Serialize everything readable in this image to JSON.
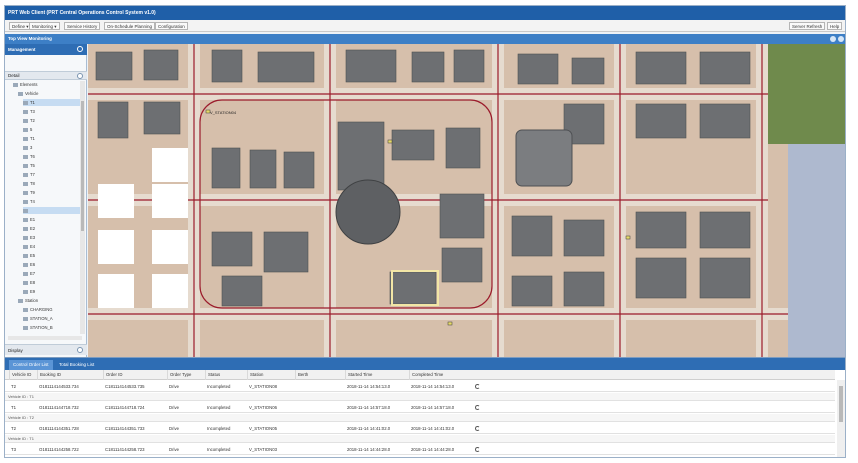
{
  "window": {
    "title": "PRT Web Client (PRT Central Operations Control System v1.0)"
  },
  "menu": {
    "define": "Define",
    "monitoring": "Monitoring",
    "service_history": "Service History",
    "on_schedule_planning": "On-Schedule Planning",
    "configuration": "Configuration",
    "server_refresh": "Server Refresh",
    "help": "Help"
  },
  "view": {
    "title": "Top View Monitoring"
  },
  "sidebar": {
    "management": "Management",
    "detail": "Detail",
    "display": "Display",
    "tree": [
      {
        "label": "Elements",
        "depth": 1
      },
      {
        "label": "Vehicle",
        "depth": 2
      },
      {
        "label": "T1",
        "depth": 3,
        "selected": true
      },
      {
        "label": "T3",
        "depth": 3
      },
      {
        "label": "T2",
        "depth": 3
      },
      {
        "label": "5",
        "depth": 3
      },
      {
        "label": "T1",
        "depth": 3
      },
      {
        "label": "3",
        "depth": 3
      },
      {
        "label": "T6",
        "depth": 3
      },
      {
        "label": "T5",
        "depth": 3
      },
      {
        "label": "T7",
        "depth": 3
      },
      {
        "label": "T8",
        "depth": 3
      },
      {
        "label": "T9",
        "depth": 3
      },
      {
        "label": "T4",
        "depth": 3
      },
      {
        "label": "",
        "depth": 3,
        "selected": true
      },
      {
        "label": "E1",
        "depth": 3
      },
      {
        "label": "E2",
        "depth": 3
      },
      {
        "label": "E3",
        "depth": 3
      },
      {
        "label": "E4",
        "depth": 3
      },
      {
        "label": "E5",
        "depth": 3
      },
      {
        "label": "E6",
        "depth": 3
      },
      {
        "label": "E7",
        "depth": 3
      },
      {
        "label": "E8",
        "depth": 3
      },
      {
        "label": "E9",
        "depth": 3
      },
      {
        "label": "Station",
        "depth": 2
      },
      {
        "label": "CHARGING",
        "depth": 3
      },
      {
        "label": "STATION_A",
        "depth": 3
      },
      {
        "label": "STATION_B",
        "depth": 3
      }
    ]
  },
  "map": {
    "labels": {
      "station1": "V_STATION04"
    }
  },
  "bottom": {
    "tabs": [
      "Control Order List",
      "Total Booking List"
    ],
    "columns": [
      "Vehicle ID",
      "Booking ID",
      "Order ID",
      "Order Type",
      "Status",
      "Station",
      "Berth",
      "Started Time",
      "Completed Time"
    ],
    "rows": [
      {
        "cells": [
          "T2",
          "O181114144533.734",
          "C181114144533.735",
          "Drive",
          "Incompleted",
          "V_STATION08",
          "",
          "2018-11-14 14:54:13.0",
          "2018-11-14 14:54:13.0"
        ],
        "sub": "Vehicle ID : T1"
      },
      {
        "cells": [
          "T1",
          "O181114144718.732",
          "C181114144718.724",
          "Drive",
          "Incompleted",
          "V_STATION06",
          "",
          "2018-11-14 14:57:18.0",
          "2018-11-14 14:57:18.0"
        ],
        "sub": "Vehicle ID : T2"
      },
      {
        "cells": [
          "T2",
          "O181114144351.728",
          "C181114144351.733",
          "Drive",
          "Incompleted",
          "V_STATION05",
          "",
          "2018-11-14 14:41:02.0",
          "2018-11-14 14:41:02.0"
        ],
        "sub": "Vehicle ID : T1"
      },
      {
        "cells": [
          "T3",
          "O181114144258.722",
          "C181114144258.723",
          "Drive",
          "Incompleted",
          "V_STATION03",
          "",
          "2018-11-14 14:44:28.0",
          "2018-11-14 14:44:28.0"
        ],
        "sub": ""
      }
    ]
  },
  "colors": {
    "title_bar": "#1f5fa8",
    "panel_header": "#2e6db4",
    "map_ground": "#d9c2ae",
    "road": "#e2d6c8",
    "building": "#6c6e70",
    "track": "#9b1b2b"
  }
}
